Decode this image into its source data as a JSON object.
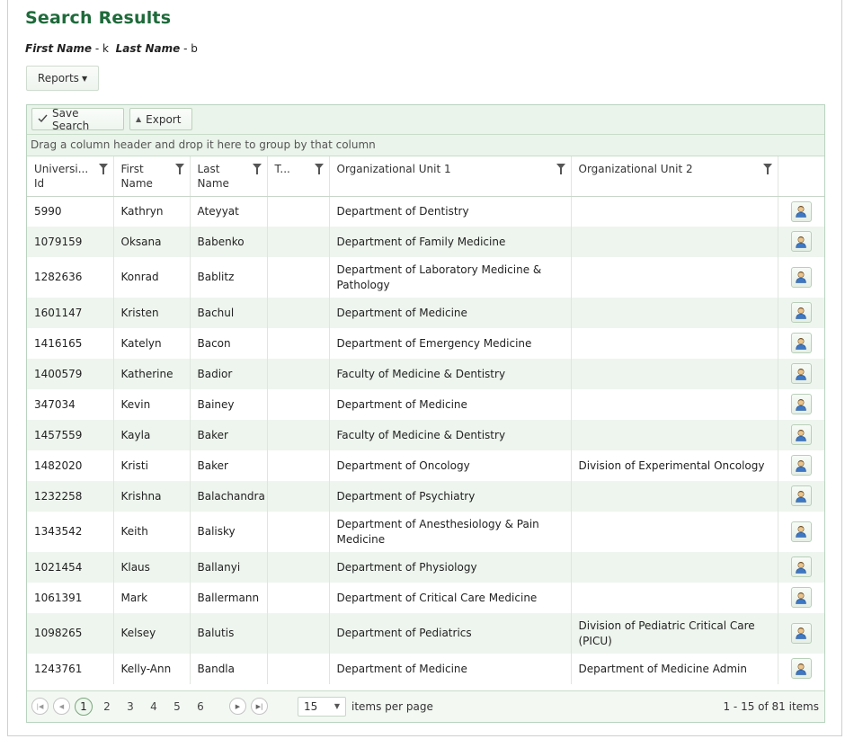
{
  "page": {
    "title": "Search Results",
    "criteria": [
      {
        "label": "First Name",
        "value": "- k"
      },
      {
        "label": "Last Name",
        "value": "- b"
      }
    ]
  },
  "reports_button": {
    "label": "Reports",
    "icon": "caret-down-icon"
  },
  "toolbar": {
    "save_label": "Save Search",
    "save_icon": "checkmark-icon",
    "export_label": "Export",
    "export_icon": "up-arrow-icon"
  },
  "group_hint": "Drag a column header and drop it here to group by that column",
  "columns": [
    {
      "key": "id",
      "label": "Universi... Id"
    },
    {
      "key": "first",
      "label": "First Name"
    },
    {
      "key": "last",
      "label": "Last Name"
    },
    {
      "key": "t",
      "label": "T..."
    },
    {
      "key": "org1",
      "label": "Organizational Unit 1"
    },
    {
      "key": "org2",
      "label": "Organizational Unit 2"
    }
  ],
  "rows": [
    {
      "id": "5990",
      "first": "Kathryn",
      "last": "Ateyyat",
      "t": "",
      "org1": "Department of Dentistry",
      "org2": ""
    },
    {
      "id": "1079159",
      "first": "Oksana",
      "last": "Babenko",
      "t": "",
      "org1": "Department of Family Medicine",
      "org2": ""
    },
    {
      "id": "1282636",
      "first": "Konrad",
      "last": "Bablitz",
      "t": "",
      "org1": "Department of Laboratory Medicine & Pathology",
      "org2": ""
    },
    {
      "id": "1601147",
      "first": "Kristen",
      "last": "Bachul",
      "t": "",
      "org1": "Department of Medicine",
      "org2": ""
    },
    {
      "id": "1416165",
      "first": "Katelyn",
      "last": "Bacon",
      "t": "",
      "org1": "Department of Emergency Medicine",
      "org2": ""
    },
    {
      "id": "1400579",
      "first": "Katherine",
      "last": "Badior",
      "t": "",
      "org1": "Faculty of Medicine & Dentistry",
      "org2": ""
    },
    {
      "id": "347034",
      "first": "Kevin",
      "last": "Bainey",
      "t": "",
      "org1": "Department of Medicine",
      "org2": ""
    },
    {
      "id": "1457559",
      "first": "Kayla",
      "last": "Baker",
      "t": "",
      "org1": "Faculty of Medicine & Dentistry",
      "org2": ""
    },
    {
      "id": "1482020",
      "first": "Kristi",
      "last": "Baker",
      "t": "",
      "org1": "Department of Oncology",
      "org2": "Division of Experimental Oncology"
    },
    {
      "id": "1232258",
      "first": "Krishna",
      "last": "Balachandra",
      "t": "",
      "org1": "Department of Psychiatry",
      "org2": ""
    },
    {
      "id": "1343542",
      "first": "Keith",
      "last": "Balisky",
      "t": "",
      "org1": "Department of Anesthesiology & Pain Medicine",
      "org2": ""
    },
    {
      "id": "1021454",
      "first": "Klaus",
      "last": "Ballanyi",
      "t": "",
      "org1": "Department of Physiology",
      "org2": ""
    },
    {
      "id": "1061391",
      "first": "Mark",
      "last": "Ballermann",
      "t": "",
      "org1": "Department of Critical Care Medicine",
      "org2": ""
    },
    {
      "id": "1098265",
      "first": "Kelsey",
      "last": "Balutis",
      "t": "",
      "org1": "Department of Pediatrics",
      "org2": "Division of Pediatric Critical Care (PICU)"
    },
    {
      "id": "1243761",
      "first": "Kelly-Ann",
      "last": "Bandla",
      "t": "",
      "org1": "Department of Medicine",
      "org2": "Department of Medicine Admin"
    }
  ],
  "row_action_icon": "person-icon",
  "pager": {
    "pages": [
      "1",
      "2",
      "3",
      "4",
      "5",
      "6"
    ],
    "current_page": "1",
    "page_size": "15",
    "items_per_page_label": "items per page",
    "info": "1 - 15 of 81 items"
  },
  "colors": {
    "title": "#1e6a3a",
    "accent": "#eaf4ea",
    "alt_row": "#eef5ee"
  }
}
